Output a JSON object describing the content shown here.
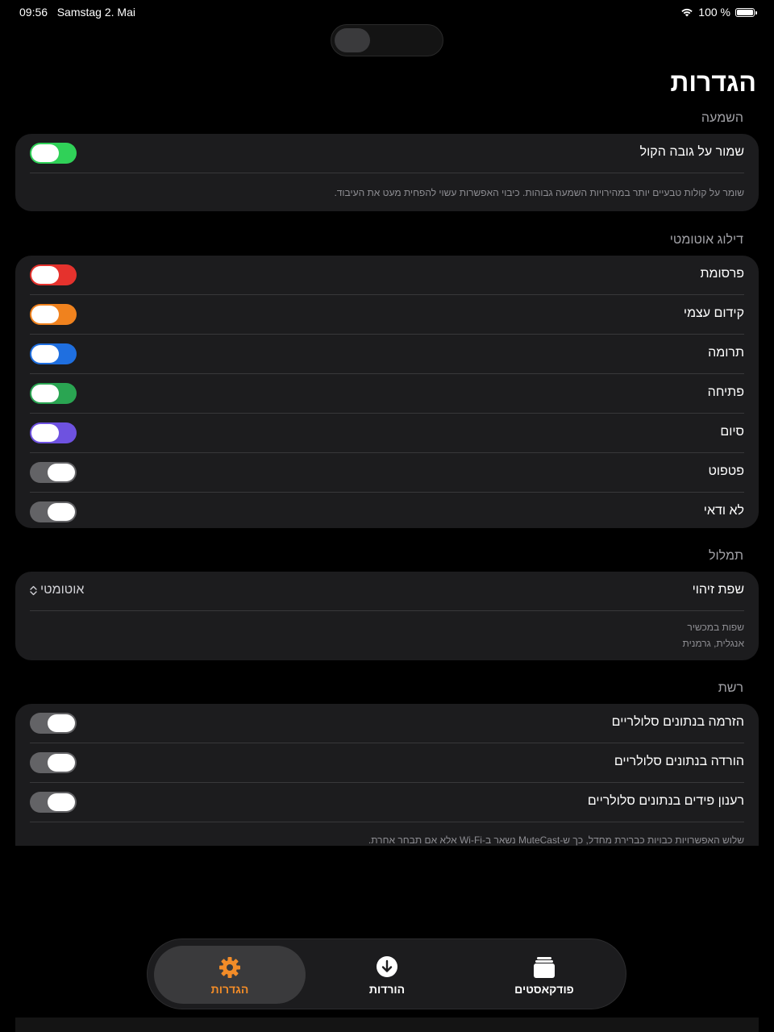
{
  "status": {
    "time": "09:56",
    "date": "Samstag 2. Mai",
    "battery": "100 %"
  },
  "title": "הגדרות",
  "sections": {
    "listening": {
      "header": "השמעה",
      "row_label": "שמור על גובה הקול",
      "toggle_color": "#30d158",
      "footnote": "שומר על קולות טבעיים יותר במהירויות השמעה גבוהות. כיבוי האפשרות עשוי להפחית מעט את העיבוד."
    },
    "autoskip": {
      "header": "דילוג אוטומטי",
      "rows": [
        {
          "label": "פרסומת",
          "on": true,
          "color": "#e5322d"
        },
        {
          "label": "קידום עצמי",
          "on": true,
          "color": "#f0821e"
        },
        {
          "label": "תרומה",
          "on": true,
          "color": "#1f6fe0"
        },
        {
          "label": "פתיחה",
          "on": true,
          "color": "#2aa552"
        },
        {
          "label": "סיום",
          "on": true,
          "color": "#6e52e0"
        },
        {
          "label": "פטפוט",
          "on": false,
          "color": "#636366"
        },
        {
          "label": "לא ודאי",
          "on": false,
          "color": "#636366"
        }
      ]
    },
    "transcription": {
      "header": "תמלול",
      "row_label": "שפת זיהוי",
      "picker_value": "אוטומטי",
      "device_langs_title": "שפות במכשיר",
      "device_langs_value": "אנגלית, גרמנית"
    },
    "network": {
      "header": "רשת",
      "rows": [
        {
          "label": "הזרמה בנתונים סלולריים",
          "on": false
        },
        {
          "label": "הורדה בנתונים סלולריים",
          "on": false
        },
        {
          "label": "רענון פידים בנתונים סלולריים",
          "on": false
        }
      ],
      "footnote": "שלוש האפשרויות כבויות כברירת מחדל, כך ש-MuteCast נשאר ב-Wi-Fi אלא אם תבחר אחרת."
    }
  },
  "tabs": [
    {
      "label": "הגדרות",
      "icon": "gear-icon",
      "active": true
    },
    {
      "label": "הורדות",
      "icon": "download-icon",
      "active": false
    },
    {
      "label": "פודקאסטים",
      "icon": "stack-icon",
      "active": false
    }
  ],
  "colors": {
    "accent": "#f28c28",
    "toggle_off": "#636366"
  }
}
